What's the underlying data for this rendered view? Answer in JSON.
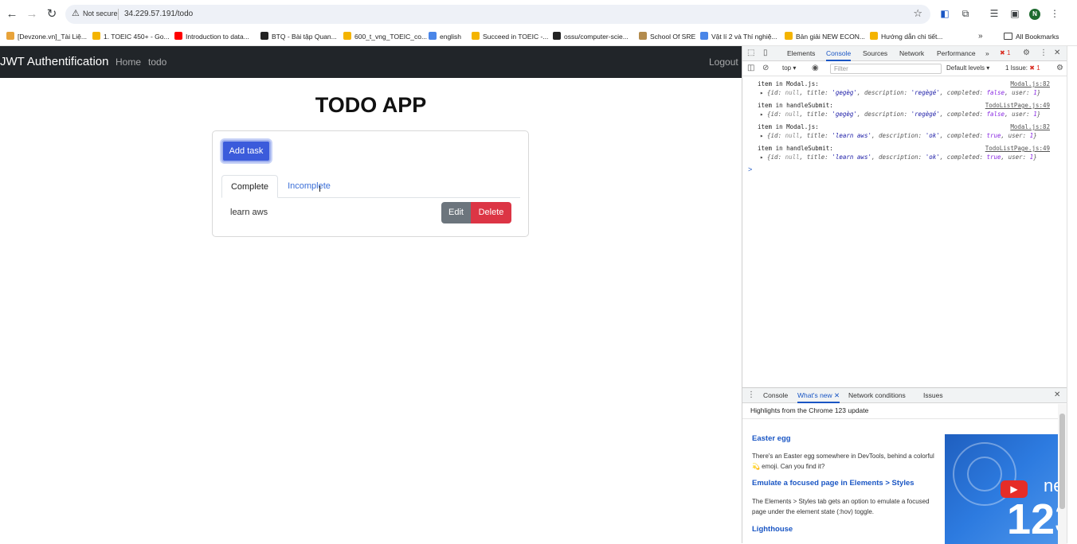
{
  "browser": {
    "not_secure": "Not secure",
    "url": "34.229.57.191/todo",
    "avatar": "N",
    "bookmarks": [
      {
        "label": "[Devzone.vn]_Tài Liệ...",
        "color": "#e8a33a"
      },
      {
        "label": "1. TOEIC 450+ - Go...",
        "color": "#f4b400"
      },
      {
        "label": "Introduction to data...",
        "color": "#ff0000"
      },
      {
        "label": "BTQ - Bài tập Quan...",
        "color": "#222222"
      },
      {
        "label": "600_t_vng_TOEIC_co...",
        "color": "#f4b400"
      },
      {
        "label": "english",
        "color": "#4a86e8"
      },
      {
        "label": "Succeed in TOEIC -...",
        "color": "#f4b400"
      },
      {
        "label": "ossu/computer-scie...",
        "color": "#222222"
      },
      {
        "label": "School Of SRE",
        "color": "#b38b4d"
      },
      {
        "label": "Vật lí 2 và Thí nghiệ...",
        "color": "#4a86e8"
      },
      {
        "label": "Bản giải NEW ECON...",
        "color": "#f4b400"
      },
      {
        "label": "Hướng dẫn chi tiết...",
        "color": "#f4b400"
      }
    ],
    "more_bookmarks": "»",
    "all_bookmarks": "All Bookmarks"
  },
  "app": {
    "brand": "JWT Authentification",
    "nav": [
      "Home",
      "todo"
    ],
    "logout": "Logout",
    "title": "TODO APP",
    "add_task": "Add task",
    "tabs": [
      "Complete",
      "Incomplete"
    ],
    "tasks": [
      {
        "title": "learn aws",
        "edit": "Edit",
        "delete": "Delete"
      }
    ]
  },
  "devtools": {
    "tabs": [
      "Elements",
      "Console",
      "Sources",
      "Network",
      "Performance"
    ],
    "more_tabs": "»",
    "error_badge": "1",
    "context": "top",
    "filter_placeholder": "Filter",
    "levels": "Default levels ▾",
    "issues_label": "1 Issue:",
    "issues_count": "1",
    "logs": [
      {
        "msg": "item in Modal.js:",
        "src": "Modal.js:82",
        "title": "'gegèg'",
        "description": "'regègé'",
        "completed": "false"
      },
      {
        "msg": "item in handleSubmit:",
        "src": "TodoListPage.js:49",
        "title": "'gegèg'",
        "description": "'regègé'",
        "completed": "false"
      },
      {
        "msg": "item in Modal.js:",
        "src": "Modal.js:82",
        "title": "'learn aws'",
        "description": "'ok'",
        "completed": "true"
      },
      {
        "msg": "item in handleSubmit:",
        "src": "TodoListPage.js:49",
        "title": "'learn aws'",
        "description": "'ok'",
        "completed": "true"
      }
    ],
    "prompt": ">",
    "drawer": {
      "tabs": [
        "Console",
        "What's new",
        "Network conditions",
        "Issues"
      ],
      "header": "Highlights from the Chrome 123 update",
      "items": [
        {
          "title": "Easter egg",
          "desc": "There's an Easter egg somewhere in DevTools, behind a colorful 💫 emoji. Can you find it?"
        },
        {
          "title": "Emulate a focused page in Elements > Styles",
          "desc": "The Elements > Styles tab gets an option to emulate a focused page under the element state (:hov) toggle."
        },
        {
          "title": "Lighthouse",
          "desc": ""
        }
      ],
      "thumb_number": "123",
      "thumb_text": "ne"
    }
  }
}
